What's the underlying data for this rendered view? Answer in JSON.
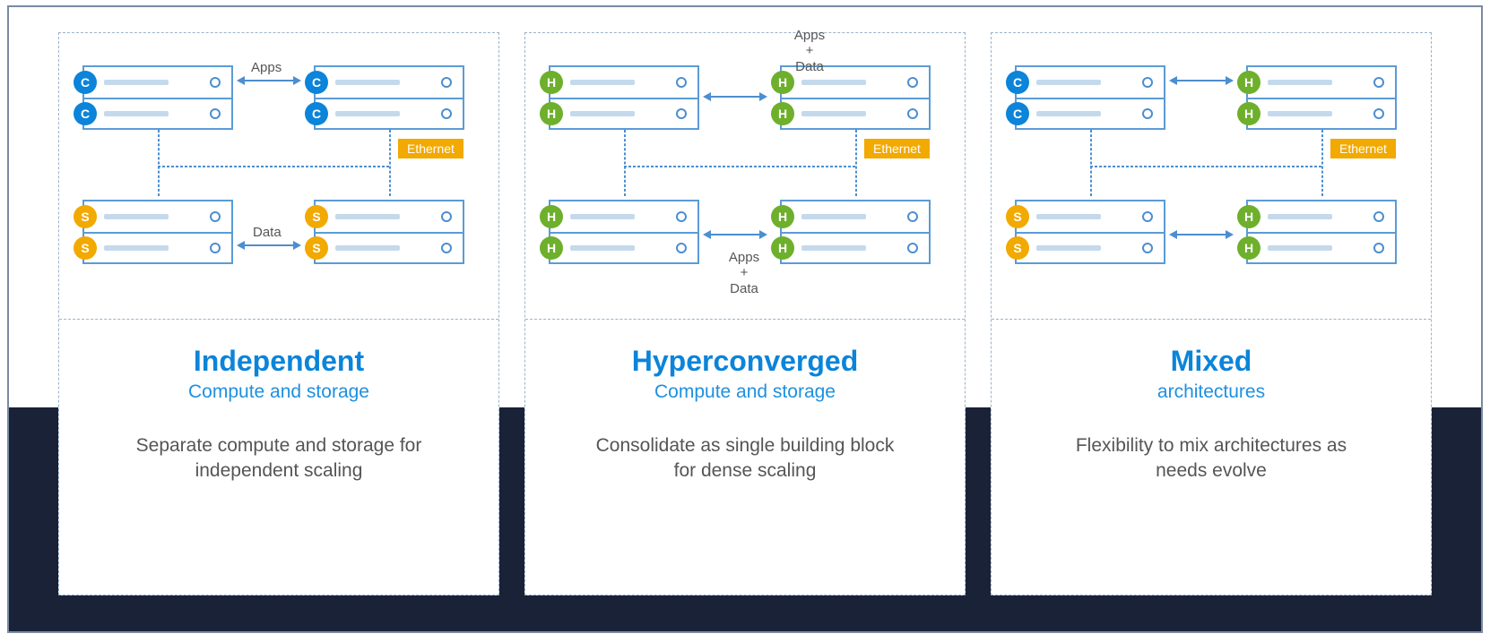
{
  "columns": [
    {
      "title": "Independent",
      "subtitle": "Compute and storage",
      "desc": "Separate compute and storage for independent scaling",
      "eth": "Ethernet",
      "top_label": "Apps",
      "bottom_label": "Data",
      "nodes": {
        "tl": [
          "C",
          "C"
        ],
        "tr": [
          "C",
          "C"
        ],
        "bl": [
          "S",
          "S"
        ],
        "br": [
          "S",
          "S"
        ]
      }
    },
    {
      "title": "Hyperconverged",
      "subtitle": "Compute and storage",
      "desc": "Consolidate as single building block for dense scaling",
      "eth": "Ethernet",
      "top_label": "Apps\n+\nData",
      "bottom_label": "Apps\n+\nData",
      "nodes": {
        "tl": [
          "H",
          "H"
        ],
        "tr": [
          "H",
          "H"
        ],
        "bl": [
          "H",
          "H"
        ],
        "br": [
          "H",
          "H"
        ]
      }
    },
    {
      "title": "Mixed",
      "subtitle": "architectures",
      "desc": "Flexibility to mix architectures as needs evolve",
      "eth": "Ethernet",
      "top_label": "",
      "bottom_label": "",
      "nodes": {
        "tl": [
          "C",
          "C"
        ],
        "tr": [
          "H",
          "H"
        ],
        "bl": [
          "S",
          "S"
        ],
        "br": [
          "H",
          "H"
        ]
      }
    }
  ]
}
